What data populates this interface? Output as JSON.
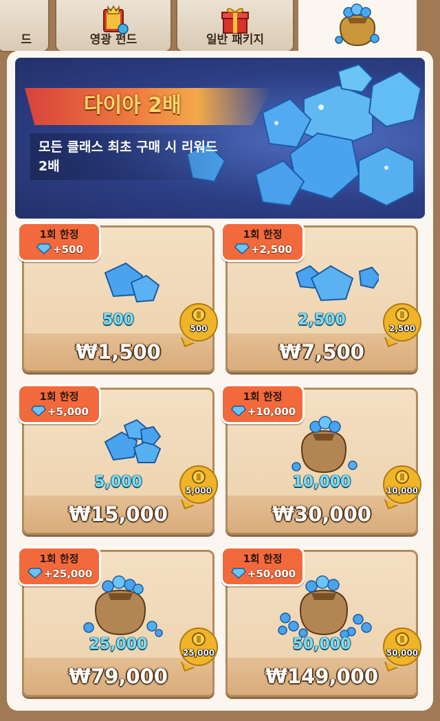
{
  "tabs": [
    {
      "label": "드"
    },
    {
      "label": "영광 펀드",
      "icon": "glory-fund-icon"
    },
    {
      "label": "일반 패키지",
      "icon": "gift-box-icon"
    },
    {
      "label": "",
      "icon": "diamond-bag-icon",
      "active": true
    }
  ],
  "banner": {
    "title": "다이아 2배",
    "description_line1": "모든 클래스 최초 구매 시 리워드",
    "description_line2": "2배"
  },
  "products": [
    {
      "limit": "1회 한정",
      "bonus": "+500",
      "amount": "500",
      "coin": "500",
      "price": "₩1,500"
    },
    {
      "limit": "1회 한정",
      "bonus": "+2,500",
      "amount": "2,500",
      "coin": "2,500",
      "price": "₩7,500"
    },
    {
      "limit": "1회 한정",
      "bonus": "+5,000",
      "amount": "5,000",
      "coin": "5,000",
      "price": "₩15,000"
    },
    {
      "limit": "1회 한정",
      "bonus": "+10,000",
      "amount": "10,000",
      "coin": "10,000",
      "price": "₩30,000"
    },
    {
      "limit": "1회 한정",
      "bonus": "+25,000",
      "amount": "25,000",
      "coin": "25,000",
      "price": "₩79,000"
    },
    {
      "limit": "1회 한정",
      "bonus": "+50,000",
      "amount": "50,000",
      "coin": "50,000",
      "price": "₩149,000"
    }
  ],
  "colors": {
    "background": "#a07a55",
    "panel": "#fbf7f0",
    "badge": "#f26a3c",
    "diamond": "#4aa8f0",
    "coin": "#f0b428"
  }
}
